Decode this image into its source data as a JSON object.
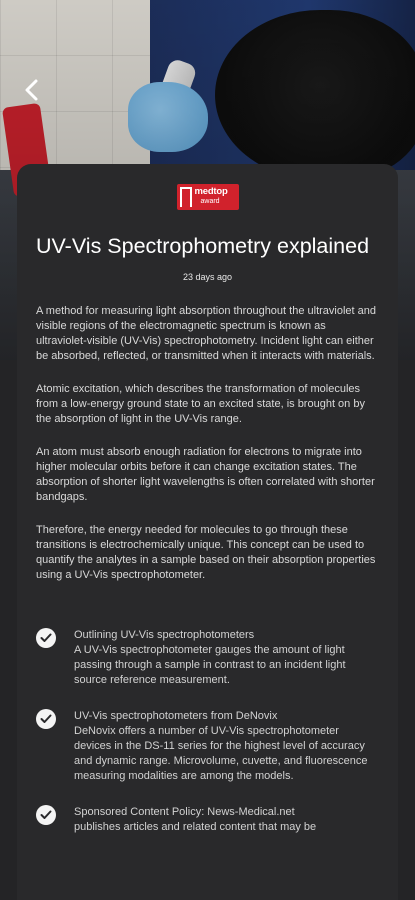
{
  "header": {
    "back_icon": "chevron-left-icon"
  },
  "article": {
    "logo_line1": "medtop",
    "logo_line2": "award",
    "title": "UV-Vis Spectrophometry explained",
    "timestamp": "23 days ago",
    "paragraphs": [
      "A method for measuring light absorption throughout the ultraviolet and visible regions of the electromagnetic spectrum is known as ultraviolet-visible (UV-Vis) spectrophotometry. Incident light can either be absorbed, reflected, or transmitted when it interacts with materials.",
      "Atomic excitation, which describes the transformation of molecules from a low-energy ground state to an excited state, is brought on by the absorption of light in the UV-Vis range.",
      "An atom must absorb enough radiation for electrons to migrate into higher molecular orbits before it can change excitation states. The absorption of shorter light wavelengths is often correlated with shorter bandgaps.",
      "Therefore, the energy needed for molecules to go through these transitions is electrochemically unique. This concept can be used to quantify the analytes in a sample based on their absorption properties using a UV-Vis spectrophotometer."
    ]
  },
  "related": [
    {
      "title": "Outlining UV-Vis spectrophotometers",
      "desc": "A UV-Vis spectrophotometer gauges the amount of light passing through a sample in contrast to an incident light source reference measurement.",
      "icon": "check-circle-icon"
    },
    {
      "title": "UV-Vis spectrophotometers from DeNovix",
      "desc": "DeNovix offers a number of UV-Vis spectrophotometer devices in the DS-11 series for the highest level of accuracy and dynamic range. Microvolume, cuvette, and fluorescence measuring modalities are among the models.",
      "icon": "check-circle-icon"
    },
    {
      "title": "Sponsored Content Policy: News-Medical.net",
      "desc": "publishes articles and related content that may be",
      "icon": "check-circle-icon"
    }
  ],
  "colors": {
    "brand_red": "#d1222c",
    "card_bg": "#29292b",
    "text_light": "#d9d9d9"
  }
}
